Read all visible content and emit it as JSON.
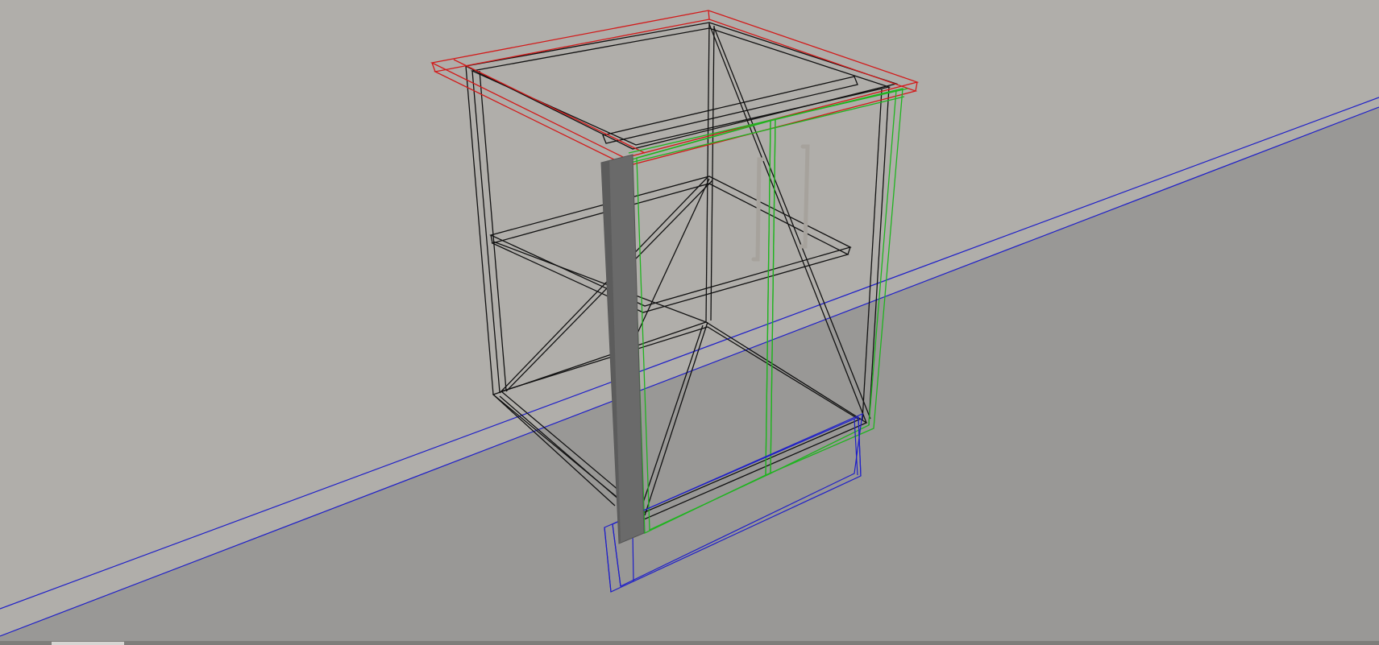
{
  "viewport": {
    "mode": "wireframe-3d",
    "colors": {
      "wall": "#b0aeaa",
      "floor": "#999896",
      "skirting": "#1f1fc8",
      "countertop": "#d21a1a",
      "carcass": "#111111",
      "door": "#1fb41f",
      "plinth": "#1f1fc8",
      "filler_panel": "#6a6a6a",
      "handle": "#a6a29c"
    },
    "objects": [
      "wall",
      "floor",
      "skirting",
      "base-cabinet-carcass",
      "countertop",
      "door-left",
      "door-right",
      "door-handles",
      "shelf",
      "plinth",
      "filler-panel"
    ]
  }
}
